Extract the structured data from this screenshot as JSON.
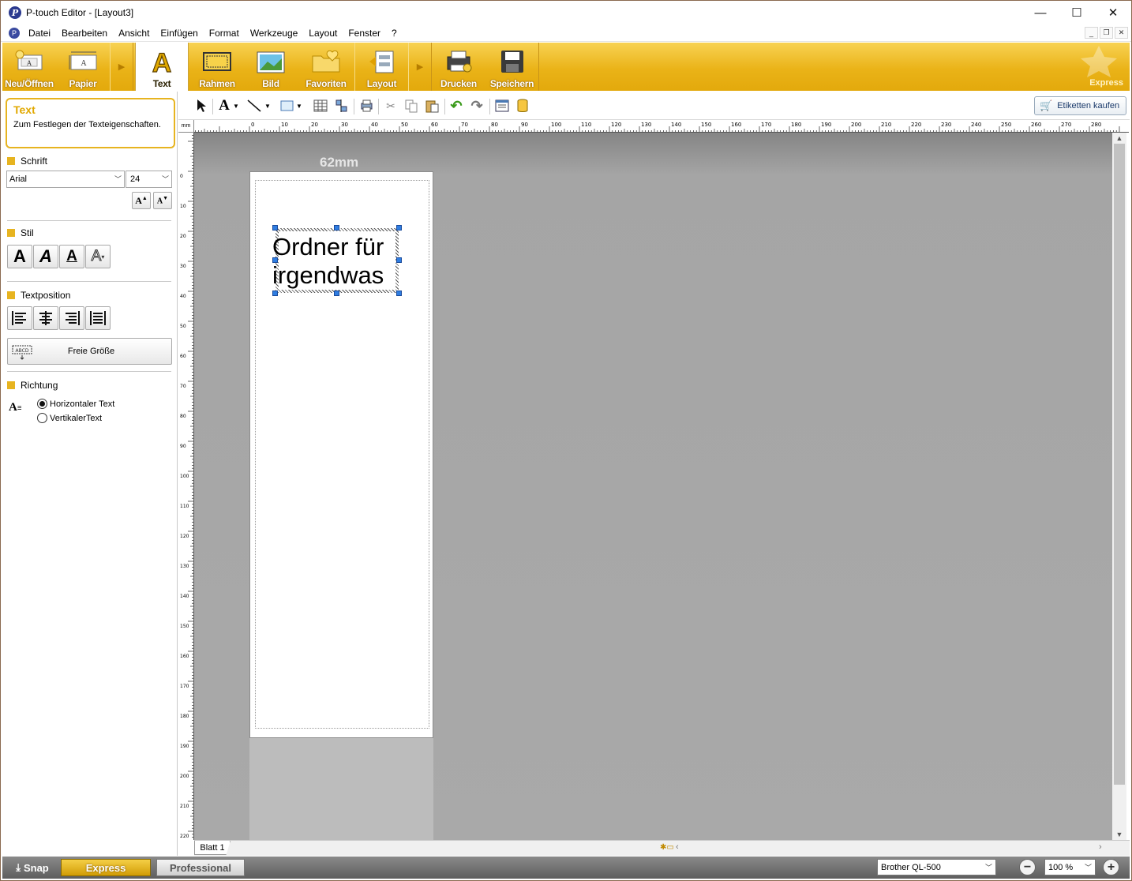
{
  "window": {
    "title": "P-touch Editor - [Layout3]",
    "minimize": "—",
    "maximize": "☐",
    "close": "✕"
  },
  "menu": [
    "Datei",
    "Bearbeiten",
    "Ansicht",
    "Einfügen",
    "Format",
    "Werkzeuge",
    "Layout",
    "Fenster",
    "?"
  ],
  "ribbon": {
    "items": [
      {
        "label": "Neu/Öffnen",
        "icon": "new-open-icon"
      },
      {
        "label": "Papier",
        "icon": "paper-icon"
      },
      {
        "label": "Text",
        "icon": "text-icon",
        "active": true
      },
      {
        "label": "Rahmen",
        "icon": "frame-icon"
      },
      {
        "label": "Bild",
        "icon": "image-icon"
      },
      {
        "label": "Favoriten",
        "icon": "favorites-icon"
      },
      {
        "label": "Layout",
        "icon": "layout-icon"
      },
      {
        "label": "Drucken",
        "icon": "print-icon"
      },
      {
        "label": "Speichern",
        "icon": "save-icon"
      }
    ],
    "mode_tag": "Express",
    "accent": "#eab318"
  },
  "panel": {
    "info_title": "Text",
    "info_desc": "Zum Festlegen der Texteigenschaften.",
    "font_section": "Schrift",
    "font": "Arial",
    "size": "24",
    "style_section": "Stil",
    "position_section": "Textposition",
    "free_size": "Freie Größe",
    "direction_section": "Richtung",
    "horizontal": "Horizontaler Text",
    "vertical": "VertikalerText",
    "horizontal_selected": true
  },
  "toolbar": {
    "buy_label": "Etiketten kaufen"
  },
  "ruler": {
    "unit": "mm",
    "h_labels": [
      "0",
      "10",
      "20",
      "30",
      "40",
      "50",
      "60",
      "70",
      "80",
      "90",
      "100",
      "110",
      "120",
      "130",
      "140",
      "150",
      "160",
      "170",
      "180",
      "190",
      "200",
      "210",
      "220",
      "230",
      "240",
      "250",
      "260",
      "270",
      "280"
    ],
    "v_labels": [
      "0",
      "10",
      "20",
      "30",
      "40",
      "50",
      "60",
      "70",
      "80",
      "90",
      "100",
      "110",
      "120",
      "130",
      "140",
      "150",
      "160",
      "170",
      "180",
      "190",
      "200",
      "210",
      "220"
    ]
  },
  "canvas": {
    "media_width": "62mm",
    "text_line1": "Ordner für",
    "text_line2": "irgendwas"
  },
  "sheet": {
    "tab": "Blatt 1"
  },
  "status": {
    "snap": "Snap",
    "express": "Express",
    "professional": "Professional",
    "printer": "Brother QL-500",
    "zoom": "100 %"
  }
}
